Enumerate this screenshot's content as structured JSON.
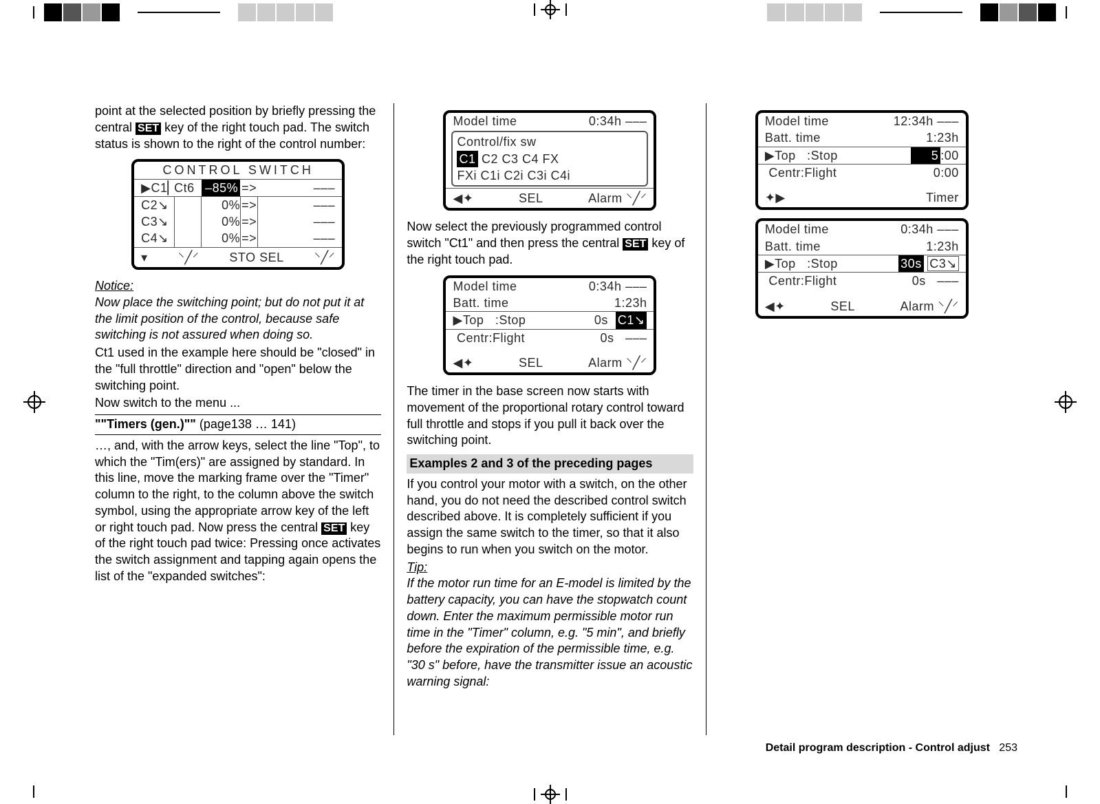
{
  "col1": {
    "intro_1": "point at the selected position by briefly pressing the central ",
    "intro_2": " key of the right touch pad. The switch status is shown to the right of the control number:",
    "notice_head": "Notice:",
    "notice_body": "Now place the switching point; but do not put it at the limit position of the control, because safe switching is not assured when doing so.",
    "p2": "Ct1 used in the example here should be \"closed\" in the \"full throttle\" direction and \"open\" below the switching point.",
    "p3": "Now switch to the menu ...",
    "menu_line": "\"\"Timers (gen.)\"\" (page138 … 141)",
    "menu_prefix": "\"\"Timers (gen.)\"\"",
    "menu_suffix": " (page138 … 141)",
    "p4": "…, and, with the arrow keys, select the line \"Top\", to which the \"Tim(ers)\" are assigned by standard. In this line, move the marking frame over the \"Timer\" column to the right, to the column above the switch symbol, using the appropriate arrow key of the left or right touch pad. Now press the central ",
    "p4b": " key of the right touch pad twice: Pressing once activates the switch assignment and tapping again opens the list of the \"expanded switches\":"
  },
  "col2": {
    "p_after_lcd1a": "Now select the previously programmed control switch \"Ct1\" and then press the central ",
    "p_after_lcd1b": " key of the right touch pad.",
    "p_after_lcd2": "The timer in the base screen now starts with movement of the proportional rotary control toward full throttle and stops if you pull it back over the switching point.",
    "subhead": "Examples 2 and 3 of the preceding pages",
    "p_examples": "If you control your motor with a switch, on the other hand, you do not need the described control switch described above. It is completely sufficient if you assign the same switch to the timer, so that it also begins to run when you switch on the motor.",
    "tip_head": "Tip:",
    "tip_body": "If the motor run time for an E-model is limited by the battery capacity, you can have the stopwatch count down. Enter the maximum permissible motor run time in the \"Timer\" column, e.g.  \"5 min\", and briefly before the expiration of the permissible time, e.g. \"30 s\" before, have the transmitter issue an acoustic warning signal:"
  },
  "lcd_control_switch": {
    "title": "CONTROL  SWITCH",
    "rows": [
      {
        "c": "▶C1▏",
        "sw": "Ct6",
        "pct": "–85%",
        "arr": "=>",
        "tail": "–––"
      },
      {
        "c": "C2↘",
        "sw": "",
        "pct": "0%",
        "arr": "=>",
        "tail": "–––"
      },
      {
        "c": "C3↘",
        "sw": "",
        "pct": "0%",
        "arr": "=>",
        "tail": "–––"
      },
      {
        "c": "C4↘",
        "sw": "",
        "pct": "0%",
        "arr": "=>",
        "tail": "–––"
      }
    ],
    "footer_left": "▾",
    "footer_mid": "STO   SEL",
    "footer_sw": "⸌╱⸍"
  },
  "lcd_modeltime": {
    "row1_l": "Model time",
    "row1_r": "0:34h –––",
    "box_line1": "Control/fix  sw",
    "box_line2_sel": "C1",
    "box_line2_rest": "  C2  C3  C4  FX",
    "box_line3": "FXi  C1i  C2i  C3i  C4i",
    "footer_left": "◀✦",
    "footer_mid": "SEL",
    "footer_right": "Alarm ⸌╱⸍"
  },
  "lcd_timer_ct1": {
    "row1_l": "Model time",
    "row1_r": "0:34h –––",
    "row2_l": "Batt. time",
    "row2_r": "1:23h",
    "row3_l": "▶Top   :Stop",
    "row3_val": "0s",
    "row3_tag": "C1↘",
    "row4_l": " Centr:Flight",
    "row4_r": "0s   –––",
    "footer_left": "◀✦",
    "footer_mid": "SEL",
    "footer_right": "Alarm ⸌╱⸍"
  },
  "lcd_col3_a": {
    "row1_l": "Model time",
    "row1_r": "12:34h –––",
    "row2_l": "Batt. time",
    "row2_r": "1:23h",
    "row3_l": "▶Top   :Stop",
    "row3_tag": "5",
    "row3_rest": ":00",
    "row4_l": " Centr:Flight",
    "row4_r": "0:00",
    "footer_left": "✦▶",
    "footer_right": "Timer"
  },
  "lcd_col3_b": {
    "row1_l": "Model time",
    "row1_r": "0:34h –––",
    "row2_l": "Batt. time",
    "row2_r": "1:23h",
    "row3_l": "▶Top   :Stop",
    "row3_tag1": "30s",
    "row3_tag2": "C3↘",
    "row4_l": " Centr:Flight",
    "row4_r": "0s   –––",
    "footer_left": "◀✦",
    "footer_mid": "SEL",
    "footer_right": "Alarm ⸌╱⸍"
  },
  "setkey": "SET",
  "footer": {
    "label": "Detail program description - Control adjust",
    "page": "253"
  }
}
